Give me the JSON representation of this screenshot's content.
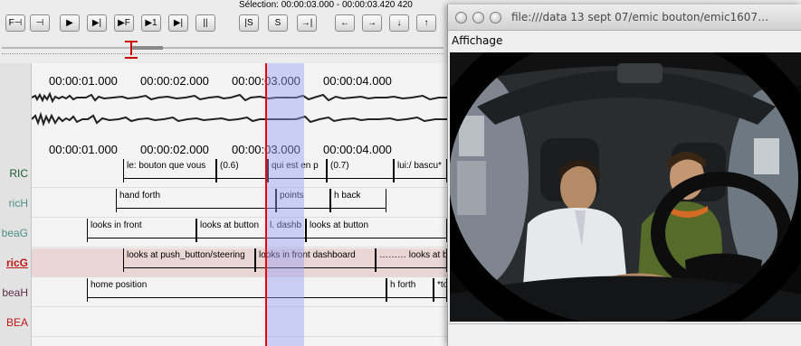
{
  "toolbar": {
    "selection_text": "Sélection: 00:00:03.000 - 00:00:03.420  420",
    "buttons": [
      "F⊣",
      "⊣",
      "▶",
      "▶|",
      "▶F",
      "▶1",
      "▶|",
      "||",
      "|S",
      "S",
      "→|",
      "←",
      "→",
      "↓",
      "↑"
    ]
  },
  "ruler": {
    "labels": [
      "00:00:01.000",
      "00:00:02.000",
      "00:00:03.000",
      "00:00:04.000"
    ]
  },
  "tiers": [
    {
      "name": "RIC",
      "color": "#1a5a34",
      "underline": false,
      "highlighted": false,
      "annotations": [
        "le: bouton que vous",
        "(0.6)",
        "qui est en p",
        "(0.7)",
        "lui:/ bascu*"
      ]
    },
    {
      "name": "ricH",
      "color": "#4b9186",
      "underline": false,
      "highlighted": false,
      "annotations": [
        "hand forth",
        "points",
        "h back"
      ]
    },
    {
      "name": "beaG",
      "color": "#4b9186",
      "underline": false,
      "highlighted": false,
      "annotations": [
        "looks in front",
        "looks at button",
        "l. dashb",
        "looks at button"
      ]
    },
    {
      "name": "ricG",
      "color": "#c01616",
      "underline": true,
      "highlighted": true,
      "annotations": [
        "looks at push_button/steering",
        "looks in front dashboard",
        "……… looks at b"
      ]
    },
    {
      "name": "beaH",
      "color": "#5d2a4a",
      "underline": false,
      "highlighted": false,
      "annotations": [
        "home position",
        "h forth",
        "*to"
      ]
    },
    {
      "name": "BEA",
      "color": "#c01616",
      "underline": false,
      "highlighted": false,
      "annotations": []
    }
  ],
  "video_window": {
    "title": "file:///data 13 sept 07/emic bouton/emic1607…",
    "menu_title": "Affichage"
  }
}
